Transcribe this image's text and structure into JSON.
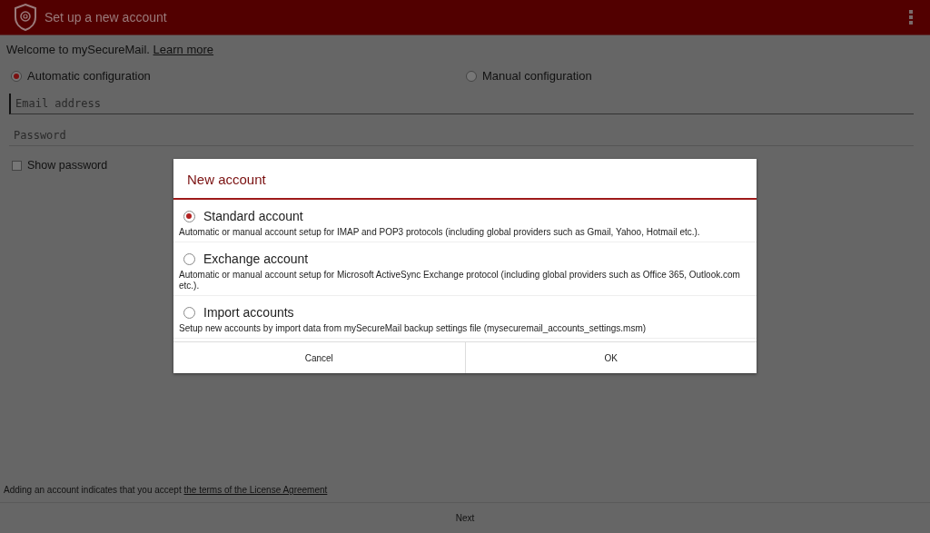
{
  "app_bar": {
    "title": "Set up a new account"
  },
  "welcome": {
    "text": "Welcome to mySecureMail.",
    "link": "Learn more"
  },
  "config_options": [
    {
      "label": "Automatic configuration",
      "selected": true
    },
    {
      "label": "Manual configuration",
      "selected": false
    }
  ],
  "fields": [
    {
      "placeholder": "Email address",
      "focused": true
    },
    {
      "placeholder": "Password",
      "focused": false
    }
  ],
  "show_password": {
    "label": "Show password",
    "checked": false
  },
  "dialog": {
    "title": "New account",
    "options": [
      {
        "label": "Standard account",
        "description": "Automatic or manual account setup for IMAP and POP3 protocols (including global providers such as Gmail, Yahoo, Hotmail etc.).",
        "selected": true
      },
      {
        "label": "Exchange account",
        "description": "Automatic or manual account setup for Microsoft ActiveSync Exchange protocol (including global providers such as Office 365, Outlook.com etc.).",
        "selected": false
      },
      {
        "label": "Import accounts",
        "description": "Setup new accounts by import data from mySecureMail backup settings file (mysecuremail_accounts_settings.msm)",
        "selected": false
      }
    ],
    "buttons": [
      "Cancel",
      "OK"
    ]
  },
  "footer": {
    "text": "Adding an account indicates that you accept",
    "link": "the terms of the License Agreement"
  },
  "next_button": "Next"
}
